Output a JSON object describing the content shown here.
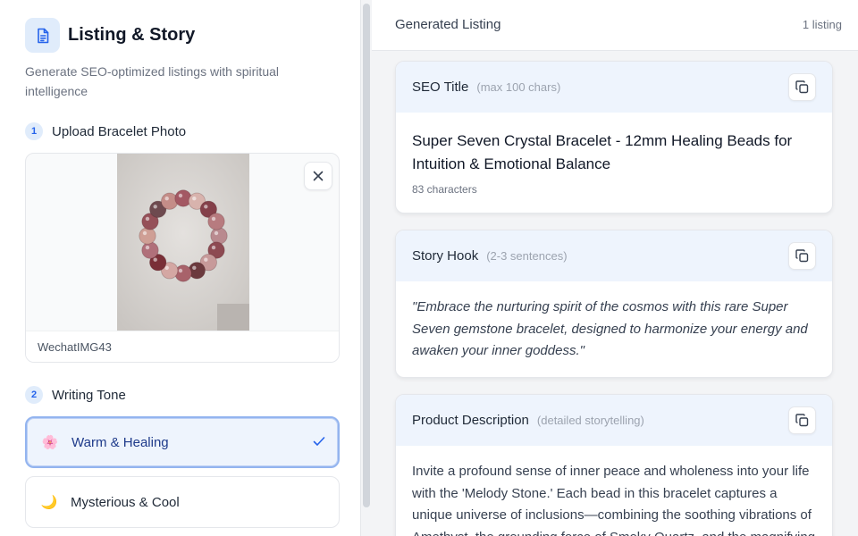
{
  "sidebar": {
    "header": {
      "title": "Listing & Story",
      "subtitle": "Generate SEO-optimized listings with spiritual intelligence",
      "icon": "document-icon"
    },
    "steps": [
      {
        "num": "1",
        "label": "Upload Bracelet Photo"
      },
      {
        "num": "2",
        "label": "Writing Tone"
      }
    ],
    "upload": {
      "filename": "WechatIMG43",
      "remove_icon": "close-icon"
    },
    "tones": [
      {
        "emoji": "🌸",
        "label": "Warm & Healing",
        "selected": true
      },
      {
        "emoji": "🌙",
        "label": "Mysterious & Cool",
        "selected": false
      }
    ]
  },
  "main": {
    "header": {
      "title": "Generated Listing",
      "count": "1 listing"
    },
    "cards": {
      "seo": {
        "label": "SEO Title",
        "hint": "(max 100 chars)",
        "value": "Super Seven Crystal Bracelet - 12mm Healing Beads for Intuition & Emotional Balance",
        "char_count": "83 characters"
      },
      "hook": {
        "label": "Story Hook",
        "hint": "(2-3 sentences)",
        "value": "\"Embrace the nurturing spirit of the cosmos with this rare Super Seven gemstone bracelet, designed to harmonize your energy and awaken your inner goddess.\""
      },
      "description": {
        "label": "Product Description",
        "hint": "(detailed storytelling)",
        "value": "Invite a profound sense of inner peace and wholeness into your life with the 'Melody Stone.' Each bead in this bracelet captures a unique universe of inclusions—combining the soothing vibrations of Amethyst, the grounding force of Smoky Quartz, and the magnifying"
      }
    }
  },
  "colors": {
    "accent": "#2563eb",
    "accent_soft": "#eef4fd",
    "selected_border": "#93b4ef"
  }
}
